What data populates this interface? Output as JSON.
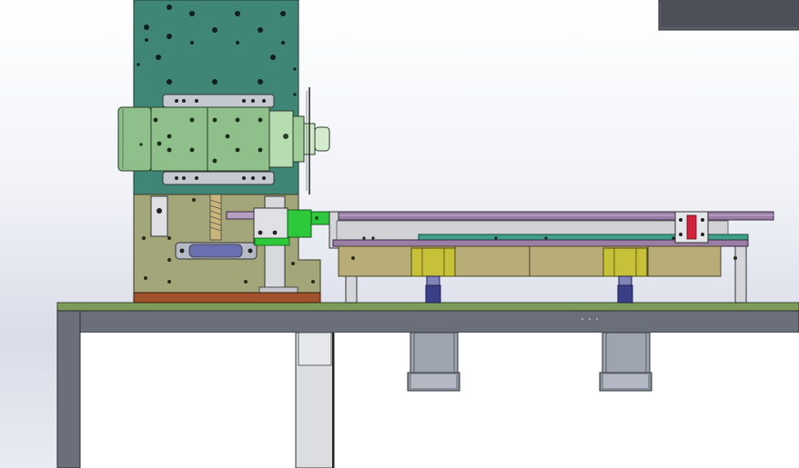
{
  "view": {
    "background_top": "#ffffff",
    "background_bottom": "#d9dde8"
  },
  "colors": {
    "column_plate": "#3f8676",
    "column_plate_dark": "#2f6b5e",
    "motor_body": "#8fbf8a",
    "motor_body_light": "#b8dcb2",
    "mount_plate": "#a3a679",
    "base_block": "#a0522d",
    "table_top": "#7d9a5a",
    "frame_steel": "#6b6f7a",
    "frame_light": "#c9ccd4",
    "rail_purple": "#9b7fa6",
    "conveyor_green": "#3fa08a",
    "guide_tan": "#b8ad78",
    "bearing_yellow": "#c7c13a",
    "foot_blue": "#3b3f86",
    "motor_gray": "#9ea3b0",
    "bright_green_part": "#2ec93a",
    "accent_red": "#d2233a"
  },
  "parts": {
    "spindle": {
      "name": "spindle-motor-assembly",
      "icon": "motor-icon"
    },
    "saw_blade": {
      "name": "saw-blade",
      "icon": "blade-icon"
    },
    "rail": {
      "name": "linear-rail"
    },
    "drive_motors": {
      "count": 2,
      "icon": "stepper-motor-icon"
    },
    "lifting_screws": {
      "count": 2
    }
  }
}
